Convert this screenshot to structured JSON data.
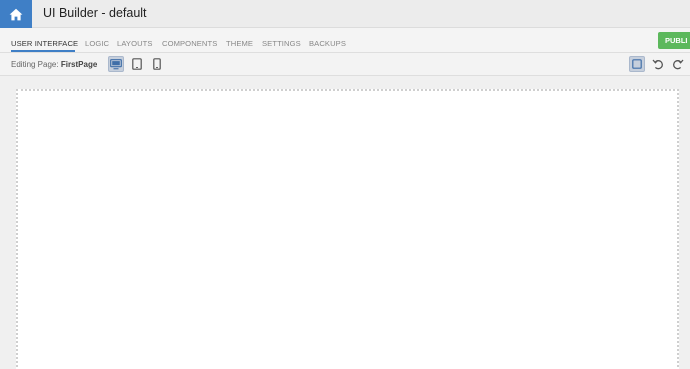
{
  "header": {
    "title": "UI Builder - default",
    "home_icon": "home-icon"
  },
  "tabs": [
    {
      "label": "USER INTERFACE",
      "active": true
    },
    {
      "label": "LOGIC"
    },
    {
      "label": "LAYOUTS"
    },
    {
      "label": "COMPONENTS"
    },
    {
      "label": "THEME"
    },
    {
      "label": "SETTINGS"
    },
    {
      "label": "BACKUPS"
    }
  ],
  "publish_label": "PUBLI",
  "toolbar": {
    "editing_prefix": "Editing Page:",
    "page_name": "FirstPage",
    "devices": [
      "desktop-icon",
      "tablet-icon",
      "mobile-icon"
    ],
    "selected_device": "desktop"
  },
  "colors": {
    "accent": "#3f7fc6",
    "publish": "#5cb85c"
  }
}
